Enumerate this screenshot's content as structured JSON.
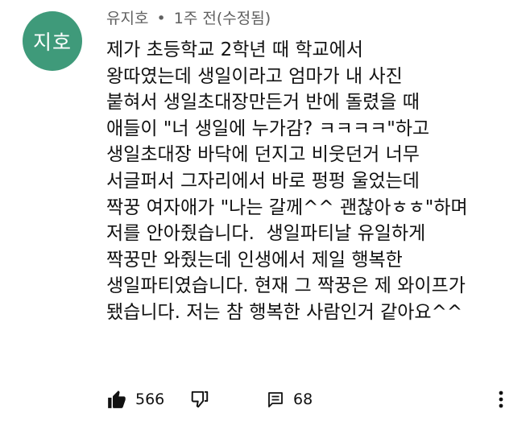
{
  "comment": {
    "avatar_text": "지호",
    "author": "유지호",
    "separator": "•",
    "time": "1주 전(수정됨)",
    "lines": [
      "제가 초등학교 2학년 때 학교에서",
      "왕따였는데 생일이라고 엄마가 내 사진",
      "붙혀서 생일초대장만든거 반에 돌렸을 때",
      "애들이 \"너 생일에 누가감? ㅋㅋㅋㅋ\"하고",
      "생일초대장 바닥에 던지고 비웃던거 너무",
      "서글퍼서 그자리에서 바로 펑펑 울었는데",
      "짝꿍 여자애가 \"나는 갈께^^ 괜찮아ㅎㅎ\"하며",
      "저를 안아줬습니다.  생일파티날 유일하게",
      "짝꿍만 와줬는데 인생에서 제일 행복한",
      "생일파티였습니다. 현재 그 짝꿍은 제 와이프가",
      "됐습니다. 저는 참 행복한 사람인거 같아요^^"
    ],
    "likes": "566",
    "replies": "68"
  },
  "icons": {
    "like": "thumbs-up-icon",
    "dislike": "thumbs-down-icon",
    "reply": "reply-icon",
    "more": "more-vertical-icon"
  },
  "colors": {
    "avatar_bg": "#3f9a7a",
    "meta_text": "#606060",
    "body_text": "#111111"
  }
}
